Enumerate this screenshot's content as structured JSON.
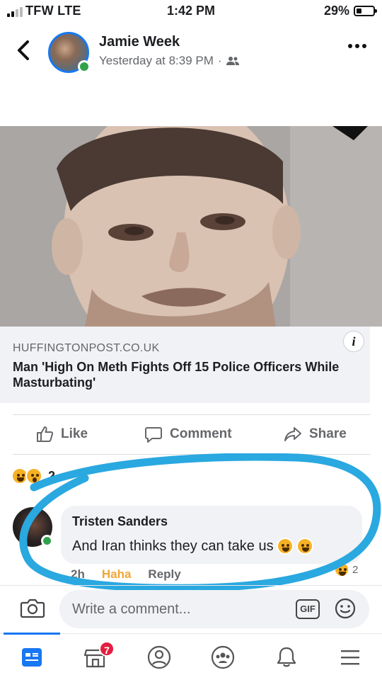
{
  "status_bar": {
    "carrier": "TFW LTE",
    "time": "1:42 PM",
    "battery_percent": "29%",
    "battery_level": 0.29,
    "signal_bars": 2
  },
  "post": {
    "author": "Jamie Week",
    "timestamp": "Yesterday at 8:39 PM",
    "separator": "·",
    "audience_icon": "friends-icon"
  },
  "link": {
    "domain": "HUFFINGTONPOST.CO.UK",
    "title": "Man 'High On Meth Fights Off 15 Police Officers While Masturbating'",
    "info_icon": "i"
  },
  "actions": {
    "like": "Like",
    "comment": "Comment",
    "share": "Share"
  },
  "reactions": {
    "count": "2",
    "types": [
      "haha",
      "wow"
    ]
  },
  "comment": {
    "author": "Tristen Sanders",
    "text": "And Iran thinks they can take us",
    "emojis": [
      "😂",
      "🤣"
    ],
    "time": "2h",
    "my_reaction": "Haha",
    "reply": "Reply",
    "reaction_count": "2"
  },
  "composer": {
    "placeholder": "Write a comment...",
    "gif": "GIF"
  },
  "nav": {
    "marketplace_badge": "7"
  },
  "colors": {
    "accent": "#1877f2",
    "annotation": "#2aa8e0",
    "haha": "#f2a534",
    "online": "#31a24c"
  }
}
